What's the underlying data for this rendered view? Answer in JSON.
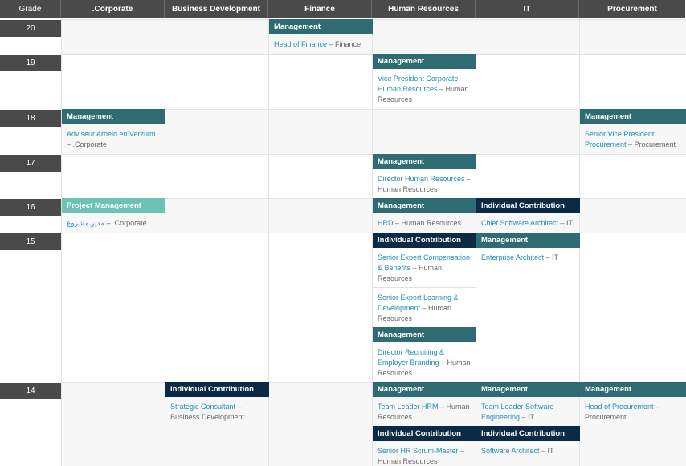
{
  "headers": {
    "grade": "Grade",
    "departments": [
      ".Corporate",
      "Business Development",
      "Finance",
      "Human Resources",
      "IT",
      "Procurement"
    ]
  },
  "grades": [
    "20",
    "19",
    "18",
    "17",
    "16",
    "15",
    "14"
  ],
  "tags": {
    "management": "Management",
    "individual": "Individual Contribution",
    "project": "Project Management"
  },
  "jobs": {
    "g20_fin": {
      "title": "Head of Finance",
      "dept": " – Finance"
    },
    "g19_hr": {
      "title": "Vice President Corporate Human Resources",
      "dept": " – Human Resources"
    },
    "g18_corp": {
      "title": "Adviseur Arbeid en Verzuim",
      "dept": " – .Corporate"
    },
    "g18_proc": {
      "title": "Senior Vice President Procurement",
      "dept": " – Procurement"
    },
    "g17_hr": {
      "title": "Director Human Resources",
      "dept": " – Human Resources"
    },
    "g16_corp": {
      "title": "مدير مشروع",
      "dept": " – .Corporate"
    },
    "g16_hr": {
      "title": "HRD",
      "dept": " – Human Resources"
    },
    "g16_it": {
      "title": "Chief Software Architect",
      "dept": " – IT"
    },
    "g15_hr1": {
      "title": "Senior Expert Compensation & Benefits",
      "dept": " – Human Resources"
    },
    "g15_hr2": {
      "title": "Senior Expert Learning & Development",
      "dept": " – Human Resources"
    },
    "g15_hr3": {
      "title": "Director Recruiting & Employer Branding",
      "dept": " – Human Resources"
    },
    "g15_it": {
      "title": "Enterprise Architect",
      "dept": " – IT"
    },
    "g14_bd": {
      "title": "Strategic Consultant",
      "dept": " – Business Development"
    },
    "g14_hr1": {
      "title": "Team Leader HRM",
      "dept": " – Human Resources"
    },
    "g14_hr2": {
      "title": "Senior HR Scrum-Master",
      "dept": " – Human Resources"
    },
    "g14_it1": {
      "title": "Team Leader Software Engineering",
      "dept": " – IT"
    },
    "g14_it2": {
      "title": "Software Architect",
      "dept": " – IT"
    },
    "g14_proc": {
      "title": "Head of Procurement",
      "dept": " – Procurement"
    }
  }
}
